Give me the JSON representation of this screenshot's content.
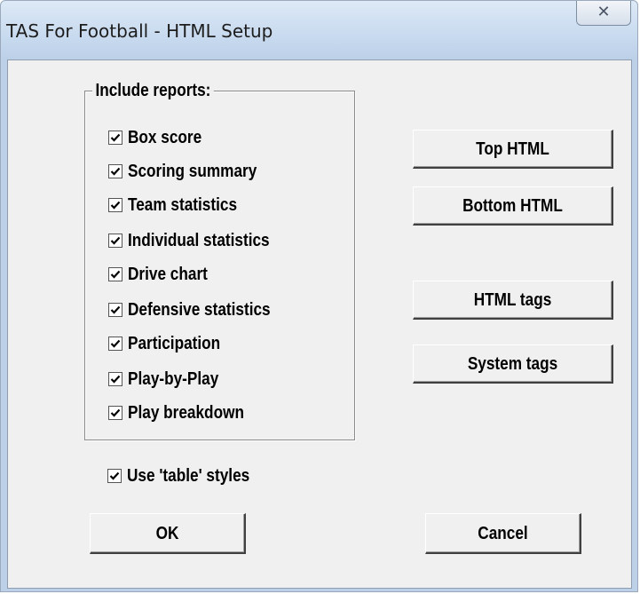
{
  "window": {
    "title": "TAS For Football - HTML Setup",
    "close_icon": "close-icon",
    "close_glyph": "✕"
  },
  "group": {
    "legend": "Include reports:",
    "items": [
      {
        "label": "Box score",
        "checked": true
      },
      {
        "label": "Scoring summary",
        "checked": true
      },
      {
        "label": "Team statistics",
        "checked": true
      },
      {
        "label": "Individual statistics",
        "checked": true
      },
      {
        "label": "Drive chart",
        "checked": true
      },
      {
        "label": "Defensive statistics",
        "checked": true
      },
      {
        "label": "Participation",
        "checked": true
      },
      {
        "label": "Play-by-Play",
        "checked": true
      },
      {
        "label": "Play breakdown",
        "checked": true
      }
    ]
  },
  "options": {
    "use_table_styles": {
      "label": "Use 'table' styles",
      "checked": true
    }
  },
  "buttons": {
    "top_html": "Top HTML",
    "bottom_html": "Bottom HTML",
    "html_tags": "HTML tags",
    "system_tags": "System tags",
    "ok": "OK",
    "cancel": "Cancel"
  }
}
